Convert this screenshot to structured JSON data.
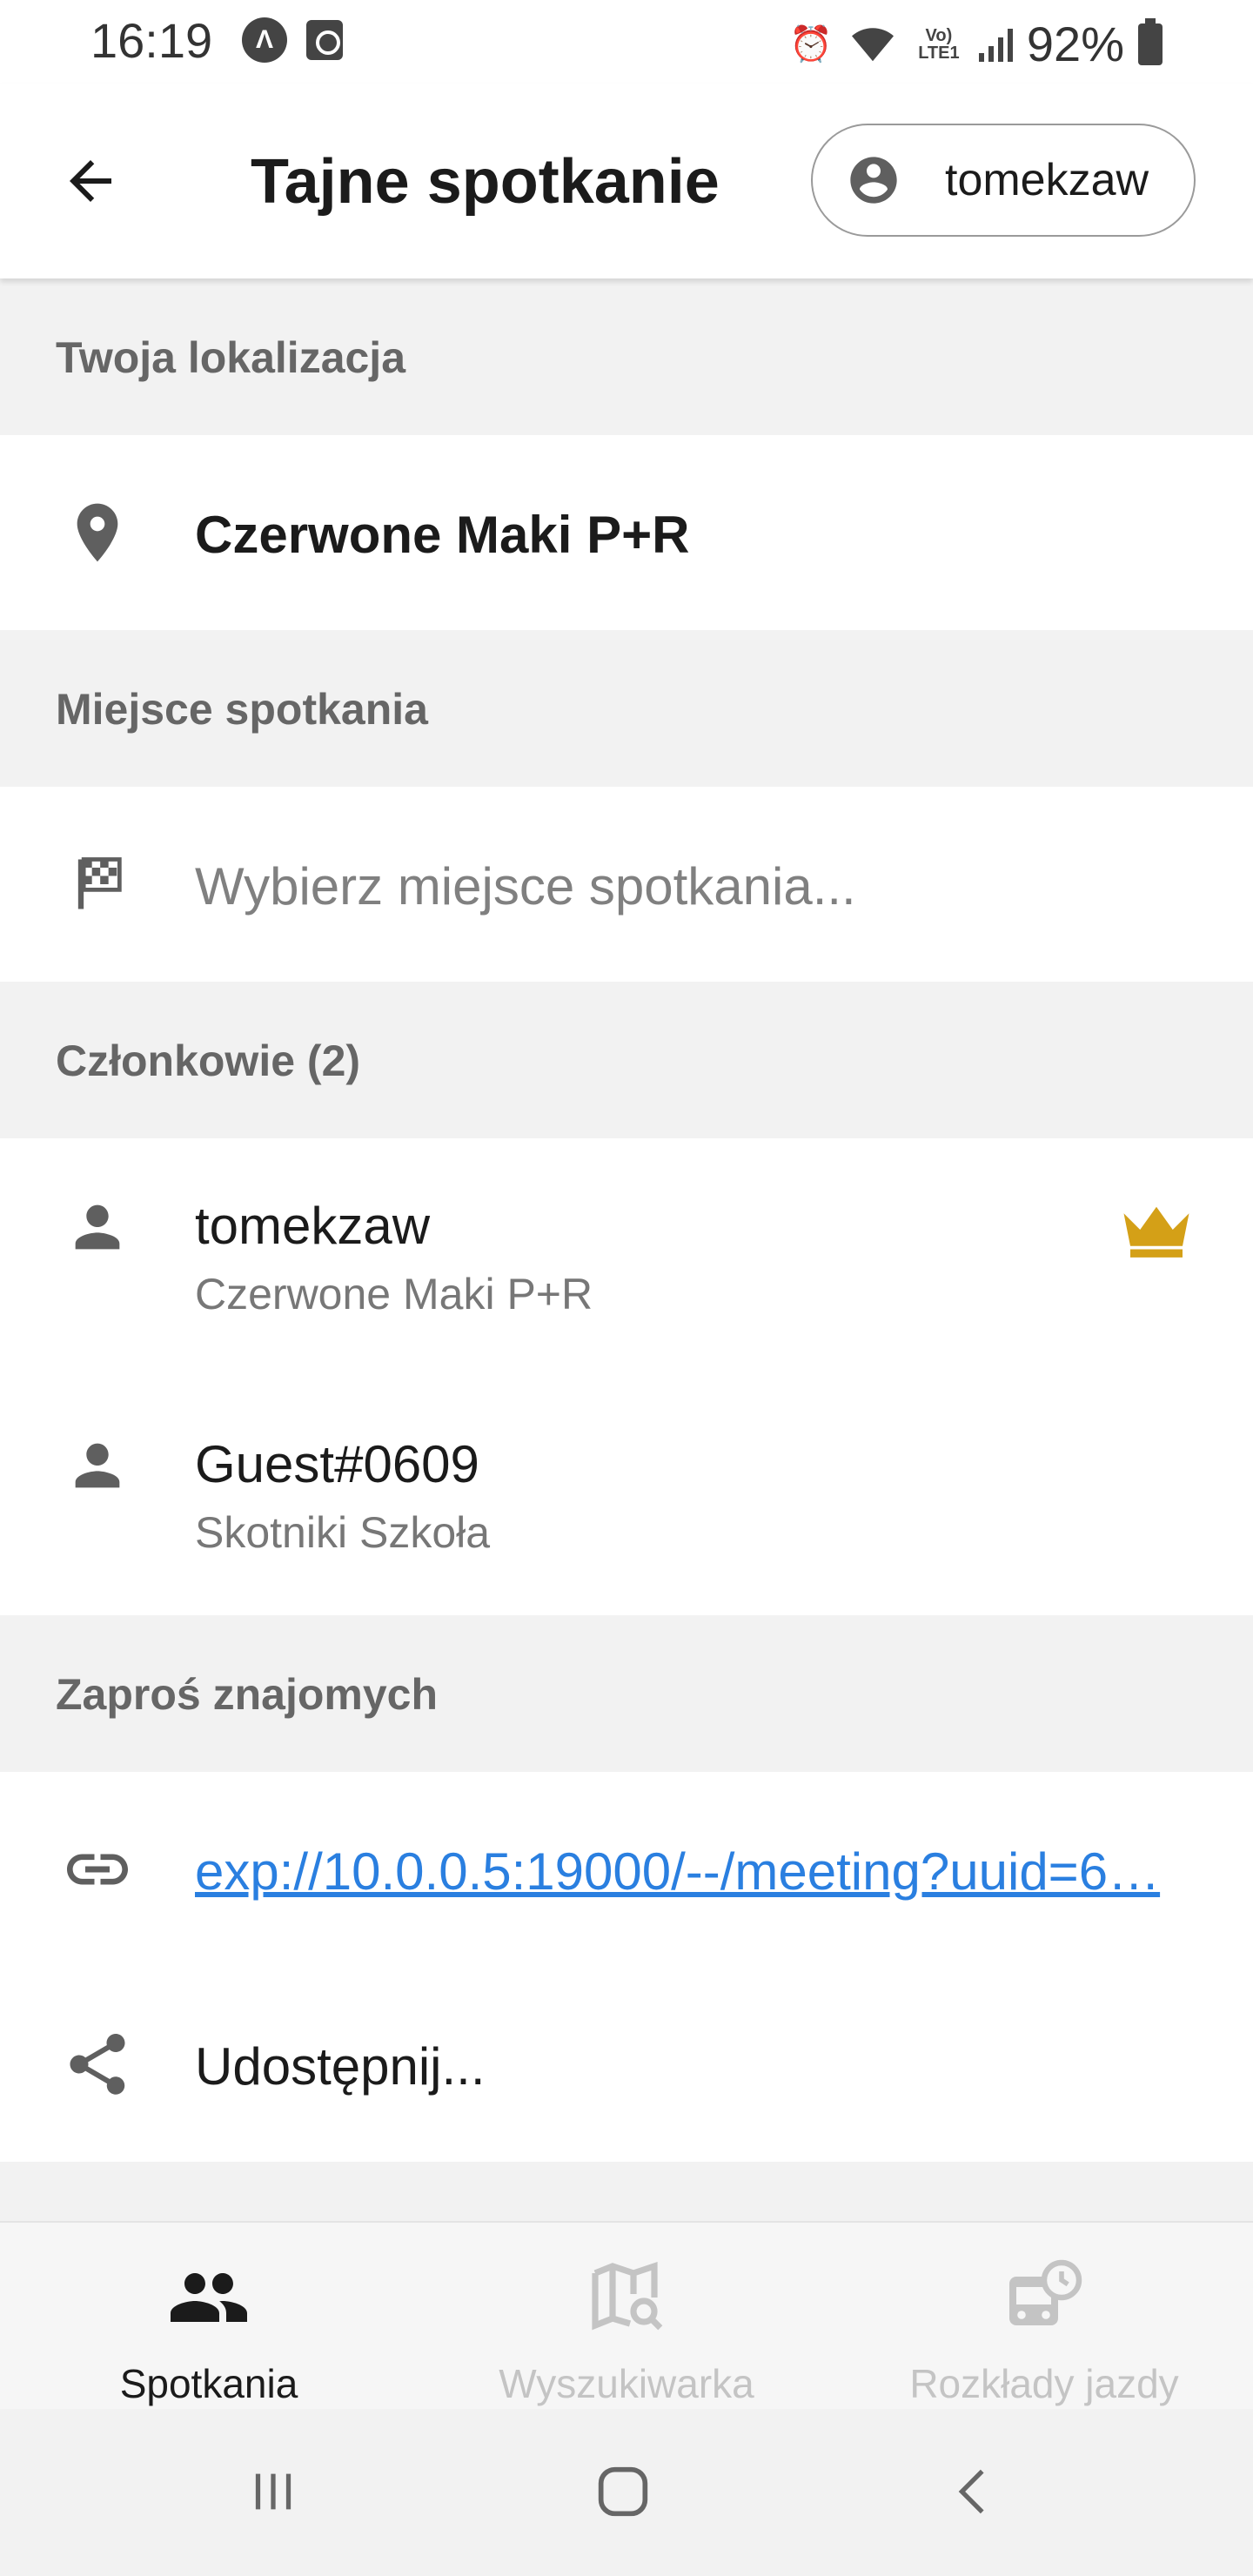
{
  "status_bar": {
    "time": "16:19",
    "battery": "92%",
    "network_label": "Vo) LTE1"
  },
  "header": {
    "title": "Tajne spotkanie",
    "user_chip": "tomekzaw"
  },
  "sections": {
    "location": {
      "header": "Twoja lokalizacja",
      "value": "Czerwone Maki P+R"
    },
    "meeting_place": {
      "header": "Miejsce spotkania",
      "placeholder": "Wybierz miejsce spotkania..."
    },
    "members": {
      "header": "Członkowie (2)",
      "items": [
        {
          "name": "tomekzaw",
          "location": "Czerwone Maki P+R",
          "is_owner": true
        },
        {
          "name": "Guest#0609",
          "location": "Skotniki Szkoła",
          "is_owner": false
        }
      ]
    },
    "invite": {
      "header": "Zaproś znajomych",
      "link": "exp://10.0.0.5:19000/--/meeting?uuid=6…",
      "share_label": "Udostępnij..."
    }
  },
  "bottom_nav": {
    "items": [
      {
        "label": "Spotkania",
        "active": true
      },
      {
        "label": "Wyszukiwarka",
        "active": false
      },
      {
        "label": "Rozkłady jazdy",
        "active": false
      }
    ]
  },
  "colors": {
    "accent_link": "#2a7fe0",
    "owner_crown": "#d4a017",
    "section_bg": "#f2f2f2"
  }
}
